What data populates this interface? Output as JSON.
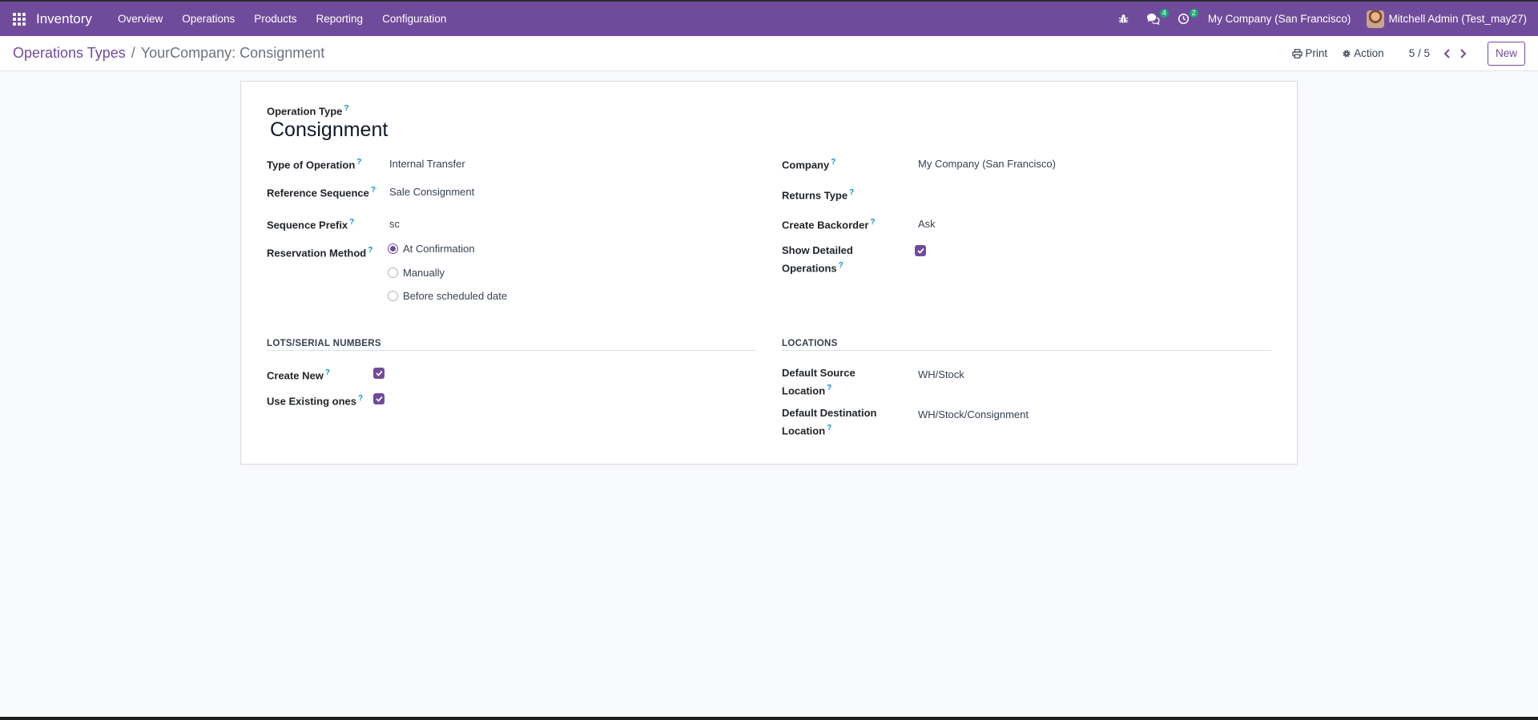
{
  "navbar": {
    "brand": "Inventory",
    "menu": [
      "Overview",
      "Operations",
      "Products",
      "Reporting",
      "Configuration"
    ],
    "messages_count": "4",
    "activities_count": "2",
    "company": "My Company (San Francisco)",
    "user": "Mitchell Admin (Test_may27)"
  },
  "breadcrumb": {
    "parent": "Operations Types",
    "separator": "/",
    "current": "YourCompany: Consignment"
  },
  "toolbar": {
    "print_label": "Print",
    "action_label": "Action",
    "pager": "5 / 5",
    "new_label": "New"
  },
  "form": {
    "operation_type_label": "Operation Type",
    "operation_type_value": "Consignment",
    "left": {
      "type_of_operation": {
        "label": "Type of Operation",
        "value": "Internal Transfer"
      },
      "reference_sequence": {
        "label": "Reference Sequence",
        "value": "Sale Consignment"
      },
      "sequence_prefix": {
        "label": "Sequence Prefix",
        "value": "sc"
      },
      "reservation_method": {
        "label": "Reservation Method",
        "options": [
          "At Confirmation",
          "Manually",
          "Before scheduled date"
        ],
        "selected": "At Confirmation"
      }
    },
    "right": {
      "company": {
        "label": "Company",
        "value": "My Company (San Francisco)"
      },
      "returns_type": {
        "label": "Returns Type",
        "value": ""
      },
      "create_backorder": {
        "label": "Create Backorder",
        "value": "Ask"
      },
      "show_detailed_operations": {
        "label_line1": "Show Detailed",
        "label_line2": "Operations",
        "checked": true
      }
    },
    "lots": {
      "title": "LOTS/SERIAL NUMBERS",
      "create_new": {
        "label": "Create New",
        "checked": true
      },
      "use_existing": {
        "label": "Use Existing ones",
        "checked": true
      }
    },
    "locations": {
      "title": "LOCATIONS",
      "default_source": {
        "label_line1": "Default Source",
        "label_line2": "Location",
        "value": "WH/Stock"
      },
      "default_destination": {
        "label_line1": "Default Destination",
        "label_line2": "Location",
        "value": "WH/Stock/Consignment"
      }
    }
  },
  "colors": {
    "brand": "#714b9b",
    "help": "#0d90c7",
    "badge": "#19a974"
  }
}
